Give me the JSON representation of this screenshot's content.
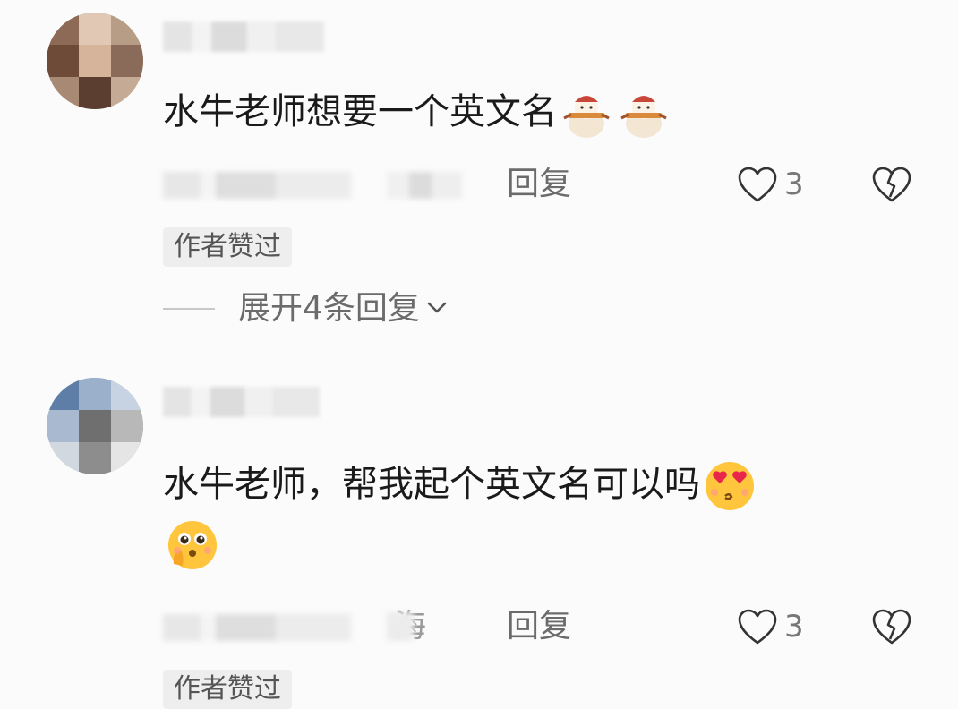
{
  "comments": [
    {
      "text": "水牛老师想要一个英文名",
      "emojis": [
        "snowman-emoji",
        "snowman-emoji"
      ],
      "region": "",
      "reply_label": "回复",
      "like_count": "3",
      "badge": "作者赞过",
      "expand_label": "展开4条回复"
    },
    {
      "text": "水牛老师，帮我起个英文名可以吗",
      "emojis": [
        "heart-eyes-emoji",
        "pleading-hands-emoji"
      ],
      "region": "海",
      "reply_label": "回复",
      "like_count": "3",
      "badge": "作者赞过"
    }
  ],
  "colors": {
    "background": "#fbfbfb",
    "text": "#1a1a1a",
    "meta_text": "#6b6b6b",
    "badge_bg": "#eeeeee"
  }
}
